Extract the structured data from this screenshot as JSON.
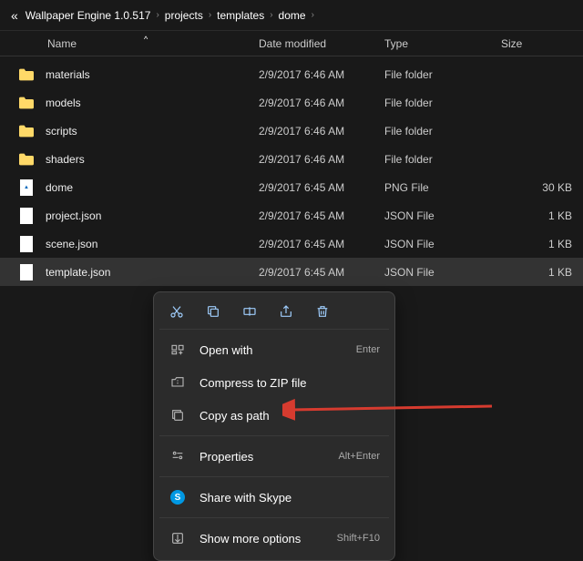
{
  "breadcrumb": {
    "prefix": "«",
    "items": [
      "Wallpaper Engine 1.0.517",
      "projects",
      "templates",
      "dome"
    ]
  },
  "columns": {
    "name": "Name",
    "date": "Date modified",
    "type": "Type",
    "size": "Size"
  },
  "files": [
    {
      "name": "materials",
      "date": "2/9/2017 6:46 AM",
      "type": "File folder",
      "size": "",
      "kind": "folder"
    },
    {
      "name": "models",
      "date": "2/9/2017 6:46 AM",
      "type": "File folder",
      "size": "",
      "kind": "folder"
    },
    {
      "name": "scripts",
      "date": "2/9/2017 6:46 AM",
      "type": "File folder",
      "size": "",
      "kind": "folder"
    },
    {
      "name": "shaders",
      "date": "2/9/2017 6:46 AM",
      "type": "File folder",
      "size": "",
      "kind": "folder"
    },
    {
      "name": "dome",
      "date": "2/9/2017 6:45 AM",
      "type": "PNG File",
      "size": "30 KB",
      "kind": "png"
    },
    {
      "name": "project.json",
      "date": "2/9/2017 6:45 AM",
      "type": "JSON File",
      "size": "1 KB",
      "kind": "file"
    },
    {
      "name": "scene.json",
      "date": "2/9/2017 6:45 AM",
      "type": "JSON File",
      "size": "1 KB",
      "kind": "file"
    },
    {
      "name": "template.json",
      "date": "2/9/2017 6:45 AM",
      "type": "JSON File",
      "size": "1 KB",
      "kind": "file",
      "selected": true
    }
  ],
  "context_menu": {
    "top_icons": [
      "cut",
      "copy",
      "rename",
      "share",
      "delete"
    ],
    "items": [
      {
        "id": "open-with",
        "label": "Open with",
        "shortcut": "Enter",
        "icon": "openwith"
      },
      {
        "id": "compress",
        "label": "Compress to ZIP file",
        "shortcut": "",
        "icon": "zip"
      },
      {
        "id": "copy-path",
        "label": "Copy as path",
        "shortcut": "",
        "icon": "copypath"
      },
      {
        "id": "properties",
        "label": "Properties",
        "shortcut": "Alt+Enter",
        "icon": "properties",
        "sep_before": true
      },
      {
        "id": "skype",
        "label": "Share with Skype",
        "shortcut": "",
        "icon": "skype",
        "sep_before": true
      },
      {
        "id": "more",
        "label": "Show more options",
        "shortcut": "Shift+F10",
        "icon": "more",
        "sep_before": true
      }
    ]
  },
  "annotation": {
    "arrow_target": "copy-path"
  }
}
